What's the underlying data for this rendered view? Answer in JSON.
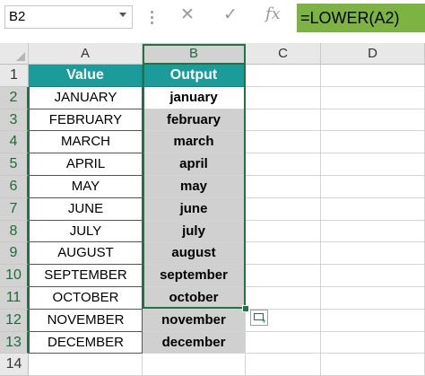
{
  "formula_bar": {
    "name_box": "B2",
    "cancel_icon": "✕",
    "enter_icon": "✓",
    "function_icon": "fx",
    "formula": "=LOWER(A2)"
  },
  "columns": [
    "A",
    "B",
    "C",
    "D"
  ],
  "rows": [
    "1",
    "2",
    "3",
    "4",
    "5",
    "6",
    "7",
    "8",
    "9",
    "10",
    "11",
    "12",
    "13",
    "14"
  ],
  "table": {
    "headers": {
      "value": "Value",
      "output": "Output"
    },
    "values": [
      "JANUARY",
      "FEBRUARY",
      "MARCH",
      "APRIL",
      "MAY",
      "JUNE",
      "JULY",
      "AUGUST",
      "SEPTEMBER",
      "OCTOBER",
      "NOVEMBER",
      "DECEMBER"
    ],
    "outputs": [
      "january",
      "february",
      "march",
      "april",
      "may",
      "june",
      "july",
      "august",
      "september",
      "october",
      "november",
      "december"
    ]
  },
  "colors": {
    "header_fill": "#1b9c9a",
    "output_fill": "#d0d0d0",
    "formula_highlight": "#7cb342",
    "selection": "#217346"
  }
}
